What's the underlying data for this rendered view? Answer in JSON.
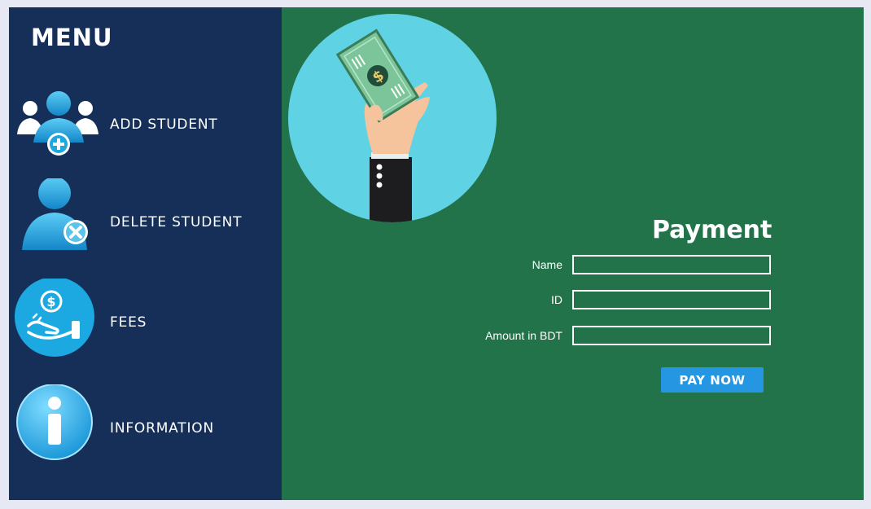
{
  "sidebar": {
    "title": "MENU",
    "items": [
      {
        "label": "ADD STUDENT",
        "icon": "add-user-icon"
      },
      {
        "label": "DELETE STUDENT",
        "icon": "delete-user-icon"
      },
      {
        "label": "FEES",
        "icon": "fees-icon"
      },
      {
        "label": "INFORMATION",
        "icon": "info-icon"
      }
    ]
  },
  "payment": {
    "title": "Payment",
    "illustration": "hand-holding-money-icon",
    "fields": [
      {
        "label": "Name",
        "value": ""
      },
      {
        "label": "ID",
        "value": ""
      },
      {
        "label": "Amount in BDT",
        "value": ""
      }
    ],
    "button_label": "PAY NOW"
  },
  "colors": {
    "sidebar_bg": "#162f58",
    "main_bg": "#22734a",
    "accent_button": "#2597e2",
    "icon_blue": "#1fa8e0",
    "page_border": "#e6e8f4"
  }
}
